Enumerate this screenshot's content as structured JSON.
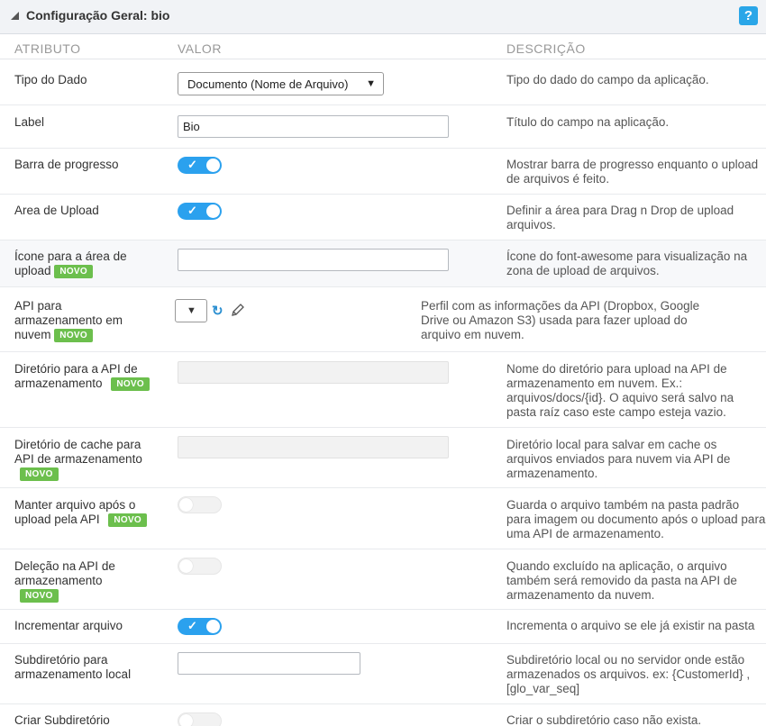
{
  "header": {
    "title": "Configuração Geral: bio",
    "help_label": "?"
  },
  "columns": {
    "attribute": "ATRIBUTO",
    "value": "VALOR",
    "description": "DESCRIÇÃO"
  },
  "badge_label": "NOVO",
  "rows": {
    "tipo": {
      "label": "Tipo do Dado",
      "select_value": "Documento (Nome de Arquivo)",
      "desc": "Tipo do dado do campo da aplicação."
    },
    "label": {
      "label": "Label",
      "input_value": "Bio",
      "desc": "Título do campo na aplicação."
    },
    "barra": {
      "label": "Barra de progresso",
      "toggle": "on",
      "desc": "Mostrar barra de progresso enquanto o upload de arquivos é feito."
    },
    "area": {
      "label": "Area de Upload",
      "toggle": "on",
      "desc": "Definir a área para Drag n Drop de upload arquivos."
    },
    "icone": {
      "label": "Ícone para a área de upload",
      "input_value": "",
      "desc": "Ícone do font-awesome para visualização na zona de upload de arquivos."
    },
    "api": {
      "label": "API para armazenamento em nuvem",
      "select_value": "",
      "desc": "Perfil com as informações da API (Dropbox, Google Drive ou Amazon S3) usada para fazer upload do arquivo em nuvem."
    },
    "diretorio": {
      "label": "Diretório para a API de armazenamento",
      "input_value": "",
      "desc": "Nome do diretório para upload na API de armazenamento em nuvem. Ex.: arquivos/docs/{id}. O aquivo será salvo na pasta raíz caso este campo esteja vazio."
    },
    "cache": {
      "label": "Diretório de cache para API de armazenamento",
      "input_value": "",
      "desc": "Diretório local para salvar em cache os arquivos enviados para nuvem via API de armazenamento."
    },
    "manter": {
      "label": "Manter arquivo após o upload pela API",
      "toggle": "off",
      "desc": "Guarda o arquivo também na pasta padrão para imagem ou documento após o upload para uma API de armazenamento."
    },
    "delecao": {
      "label": "Deleção na API de armazenamento",
      "toggle": "off",
      "desc": "Quando excluído na aplicação, o arquivo também será removido da pasta na API de armazenamento da nuvem."
    },
    "incrementar": {
      "label": "Incrementar arquivo",
      "toggle": "on",
      "desc": "Incrementa o arquivo se ele já existir na pasta"
    },
    "subdir": {
      "label": "Subdiretório para armazenamento local",
      "input_value": "",
      "desc": "Subdiretório local ou no servidor onde estão armazenados os arquivos. ex: {CustomerId} , [glo_var_seq]"
    },
    "criar": {
      "label": "Criar Subdiretório",
      "toggle": "off",
      "desc": "Criar o subdiretório caso não exista."
    }
  },
  "colors": {
    "accent": "#2ba1ee",
    "badge": "#6cbf4d",
    "help": "#2aa6e8"
  }
}
